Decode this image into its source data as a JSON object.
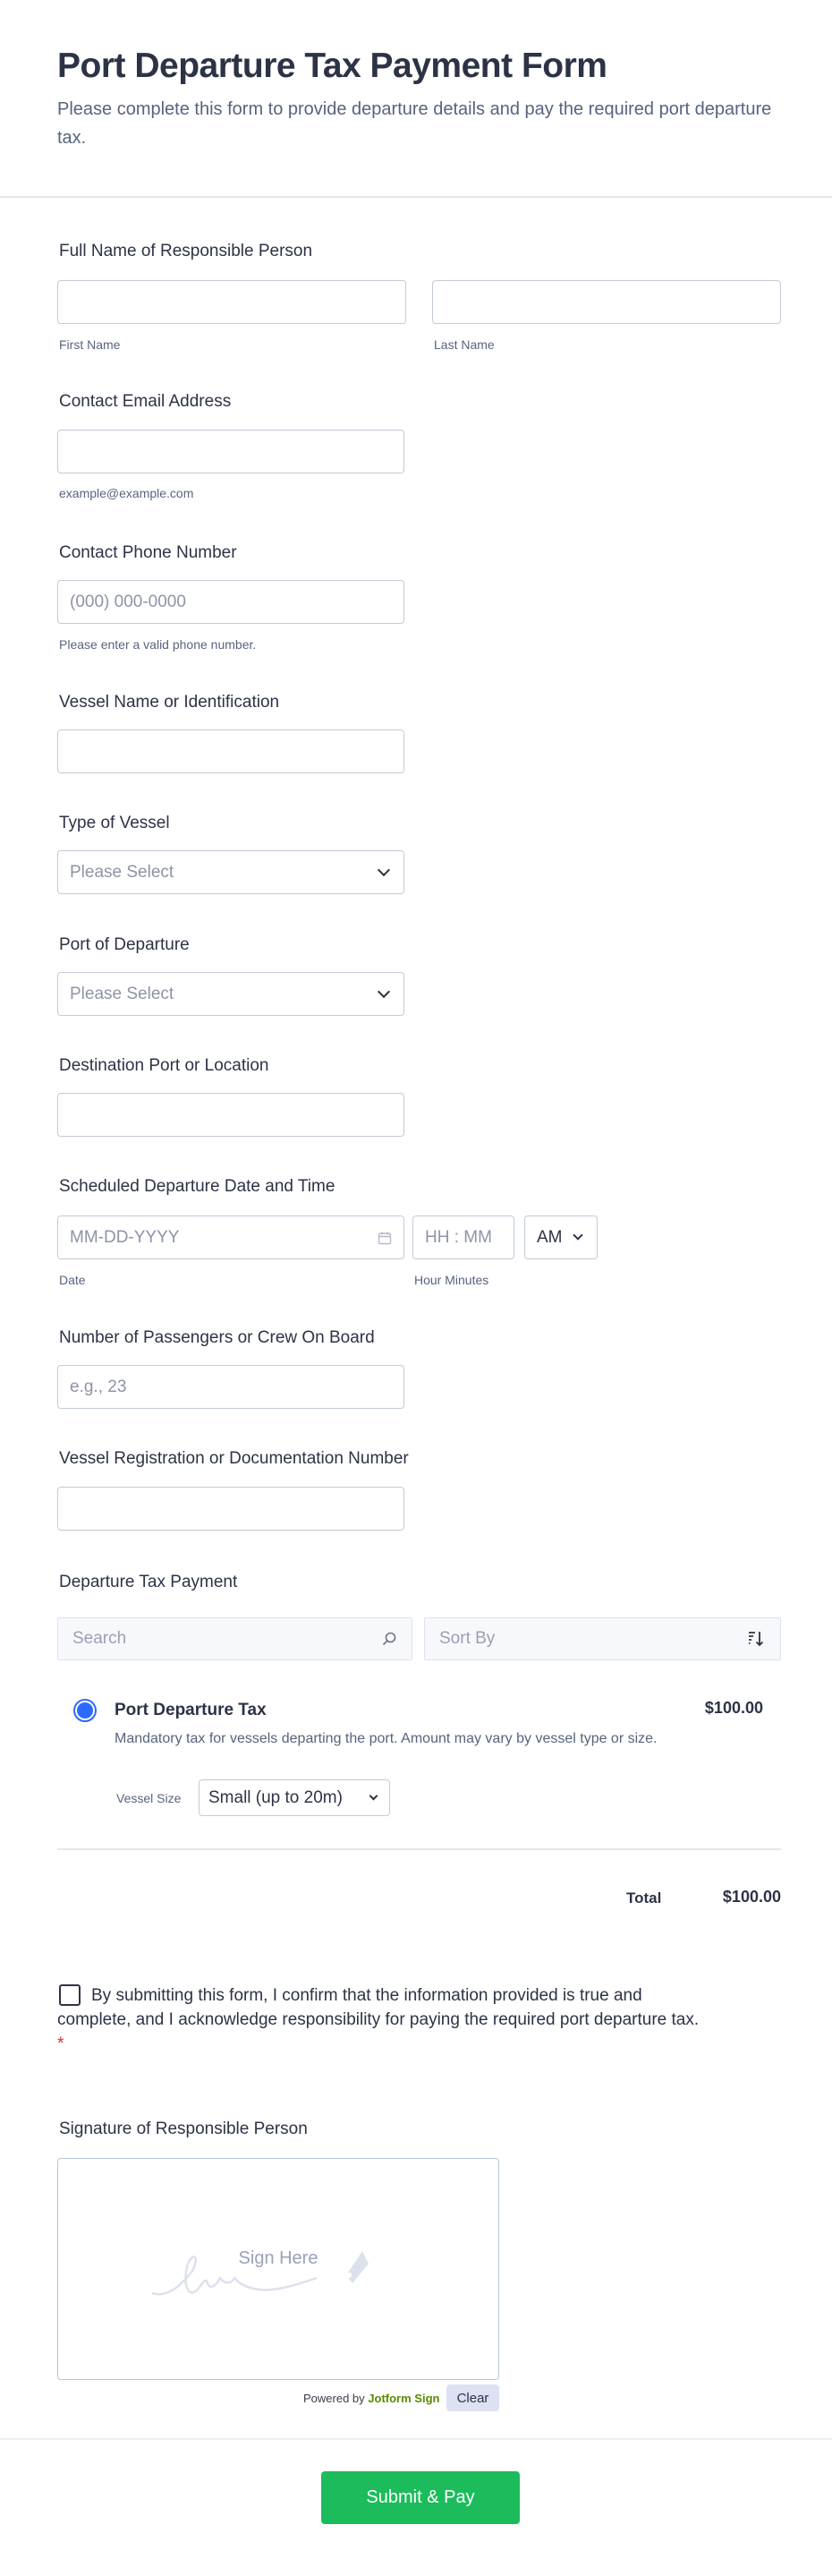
{
  "header": {
    "title": "Port Departure Tax Payment Form",
    "subtitle": "Please complete this form to provide departure details and pay the required port departure tax."
  },
  "fields": {
    "full_name": {
      "label": "Full Name of Responsible Person",
      "first": "First Name",
      "last": "Last Name"
    },
    "email": {
      "label": "Contact Email Address",
      "helper": "example@example.com"
    },
    "phone": {
      "label": "Contact Phone Number",
      "placeholder": "(000) 000-0000",
      "helper": "Please enter a valid phone number."
    },
    "vessel_name": {
      "label": "Vessel Name or Identification"
    },
    "vessel_type": {
      "label": "Type of Vessel",
      "placeholder": "Please Select"
    },
    "port": {
      "label": "Port of Departure",
      "placeholder": "Please Select"
    },
    "destination": {
      "label": "Destination Port or Location"
    },
    "datetime": {
      "label": "Scheduled Departure Date and Time",
      "date_placeholder": "MM-DD-YYYY",
      "time_placeholder": "HH : MM",
      "ampm": "AM",
      "date_sub": "Date",
      "time_sub": "Hour Minutes"
    },
    "passengers": {
      "label": "Number of Passengers or Crew On Board",
      "placeholder": "e.g., 23"
    },
    "registration": {
      "label": "Vessel Registration or Documentation Number"
    }
  },
  "payment": {
    "label": "Departure Tax Payment",
    "search_placeholder": "Search",
    "sort_label": "Sort By",
    "product": {
      "name": "Port Departure Tax",
      "price": "$100.00",
      "description": "Mandatory tax for vessels departing the port. Amount may vary by vessel type or size.",
      "option_label": "Vessel Size",
      "option_value": "Small (up to 20m)",
      "selected": true
    },
    "total_label": "Total",
    "total_value": "$100.00"
  },
  "consent": {
    "text": "By submitting this form, I confirm that the information provided is true and complete, and I acknowledge responsibility for paying the required port departure tax.",
    "required_mark": "*"
  },
  "signature": {
    "label": "Signature of Responsible Person",
    "placeholder": "Sign Here",
    "powered_by": "Powered by",
    "brand": "Jotform Sign",
    "clear": "Clear"
  },
  "submit": {
    "label": "Submit & Pay"
  },
  "colors": {
    "accent": "#2e69ff",
    "submit": "#1cbc5c",
    "brand": "#5a8a00"
  }
}
